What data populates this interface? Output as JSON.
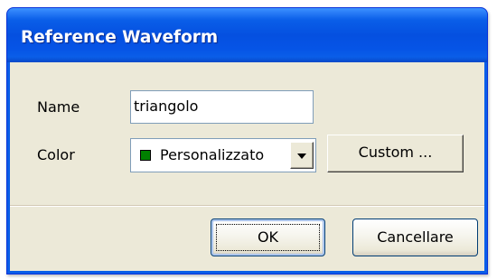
{
  "dialog": {
    "title": "Reference Waveform"
  },
  "form": {
    "name_label": "Name",
    "name_value": "triangolo",
    "color_label": "Color",
    "color_selected": "Personalizzato",
    "color_swatch": "#008000",
    "custom_button": "Custom ..."
  },
  "buttons": {
    "ok": "OK",
    "cancel": "Cancellare"
  },
  "icons": {
    "dropdown": "chevron-down-icon"
  }
}
